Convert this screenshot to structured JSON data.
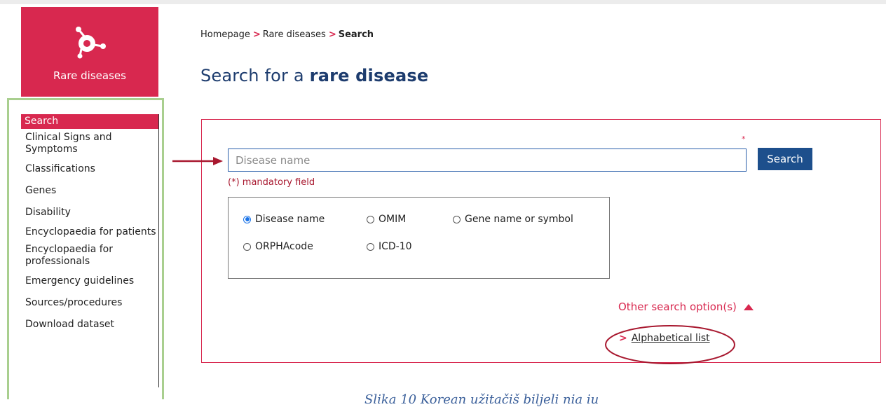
{
  "logo": {
    "label": "Rare diseases",
    "icon": "molecule-icon"
  },
  "sidebar": {
    "items": [
      {
        "label": "Search",
        "active": true
      },
      {
        "label": "Clinical Signs and Symptoms"
      },
      {
        "label": "Classifications"
      },
      {
        "label": "Genes"
      },
      {
        "label": "Disability"
      },
      {
        "label": "Encyclopaedia for patients"
      },
      {
        "label": "Encyclopaedia for professionals"
      },
      {
        "label": "Emergency guidelines"
      },
      {
        "label": "Sources/procedures"
      },
      {
        "label": "Download dataset"
      }
    ]
  },
  "breadcrumb": {
    "home": "Homepage",
    "section": "Rare diseases",
    "current": "Search",
    "separator": ">"
  },
  "title": {
    "prefix": "Search for a",
    "emphasis": "rare disease"
  },
  "search": {
    "required_marker": "*",
    "placeholder": "Disease name",
    "value": "",
    "button_label": "Search",
    "mandatory_note": "(*) mandatory field"
  },
  "search_types": [
    {
      "label": "Disease name",
      "selected": true
    },
    {
      "label": "OMIM",
      "selected": false
    },
    {
      "label": "Gene name or symbol",
      "selected": false
    },
    {
      "label": "ORPHAcode",
      "selected": false
    },
    {
      "label": "ICD-10",
      "selected": false
    }
  ],
  "other_options": {
    "label": "Other search option(s)",
    "icon": "triangle-up-icon"
  },
  "alphabetical": {
    "chevron": ">",
    "label": "Alphabetical list"
  },
  "caption": "Slika 10 Korean užitačiš biljeli nia iu",
  "colors": {
    "brand": "#d8284f",
    "navy": "#1d4f8c",
    "title": "#1d3c6e",
    "frame": "#a9cf8f",
    "annotation": "#a8182f"
  }
}
